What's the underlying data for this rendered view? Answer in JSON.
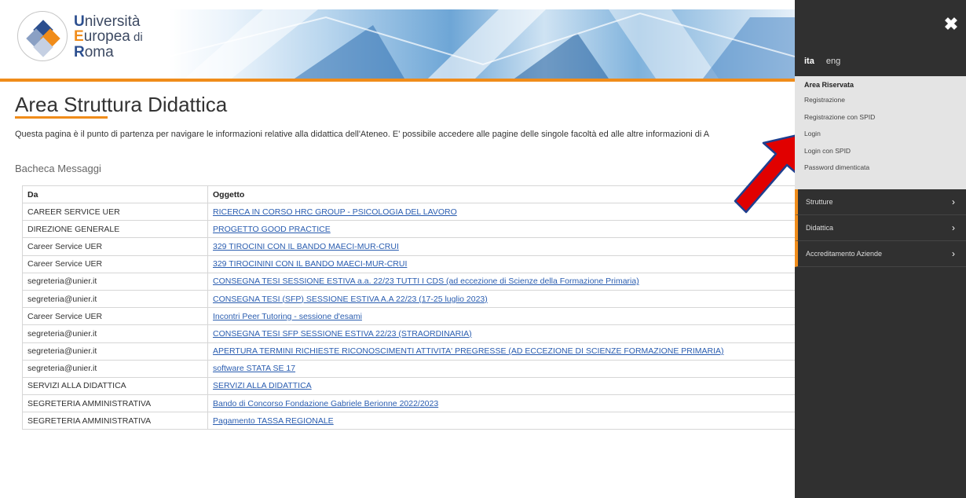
{
  "logo": {
    "line1_cap": "U",
    "line1_rest": "niversità",
    "line2_cap": "E",
    "line2_rest": "uropea",
    "line2_small": " di",
    "line3_cap": "R",
    "line3_rest": "oma"
  },
  "main": {
    "title": "Area Struttura Didattica",
    "intro": "Questa pagina è il punto di partenza per navigare le informazioni relative alla didattica dell'Ateneo. E' possibile accedere alle pagine delle singole facoltà ed alle altre informazioni di A",
    "board_title": "Bacheca Messaggi"
  },
  "table": {
    "headers": [
      "Da",
      "Oggetto"
    ],
    "rows": [
      {
        "da": "CAREER SERVICE UER",
        "oggetto": "RICERCA IN CORSO HRC GROUP - PSICOLOGIA DEL LAVORO"
      },
      {
        "da": "DIREZIONE GENERALE",
        "oggetto": "PROGETTO GOOD PRACTICE"
      },
      {
        "da": "Career Service UER",
        "oggetto": "329 TIROCINI CON IL BANDO MAECI-MUR-CRUI"
      },
      {
        "da": "Career Service UER",
        "oggetto": "329 TIROCININI CON IL BANDO MAECI-MUR-CRUI"
      },
      {
        "da": "segreteria@unier.it",
        "oggetto": "CONSEGNA TESI SESSIONE ESTIVA a.a. 22/23 TUTTI I CDS (ad eccezione di Scienze della Formazione Primaria)"
      },
      {
        "da": "segreteria@unier.it",
        "oggetto": "CONSEGNA TESI (SFP) SESSIONE ESTIVA A.A 22/23 (17-25 luglio 2023)"
      },
      {
        "da": "Career Service UER",
        "oggetto": "Incontri Peer Tutoring - sessione d'esami"
      },
      {
        "da": "segreteria@unier.it",
        "oggetto": "CONSEGNA TESI SFP SESSIONE ESTIVA 22/23 (STRAORDINARIA)"
      },
      {
        "da": "segreteria@unier.it",
        "oggetto": "APERTURA TERMINI RICHIESTE RICONOSCIMENTI ATTIVITA' PREGRESSE (AD ECCEZIONE DI SCIENZE FORMAZIONE PRIMARIA)"
      },
      {
        "da": "segreteria@unier.it",
        "oggetto": "software STATA SE 17"
      },
      {
        "da": "SERVIZI ALLA DIDATTICA",
        "oggetto": "SERVIZI ALLA DIDATTICA"
      },
      {
        "da": "SEGRETERIA AMMINISTRATIVA",
        "oggetto": "Bando di Concorso Fondazione Gabriele Berionne 2022/2023"
      },
      {
        "da": "SEGRETERIA AMMINISTRATIVA",
        "oggetto": "Pagamento TASSA REGIONALE"
      }
    ]
  },
  "side": {
    "close_icon": "close-icon",
    "lang_active": "ita",
    "lang_other": "eng",
    "reserved_head": "Area Riservata",
    "reserved_items": [
      "Registrazione",
      "Registrazione con SPID",
      "Login",
      "Login con SPID",
      "Password dimenticata"
    ],
    "menu": [
      "Strutture",
      "Didattica",
      "Accreditamento Aziende"
    ]
  },
  "colors": {
    "accent": "#f08c1a",
    "panel": "#303030",
    "link": "#2a5db0",
    "arrow": "#e10000"
  }
}
